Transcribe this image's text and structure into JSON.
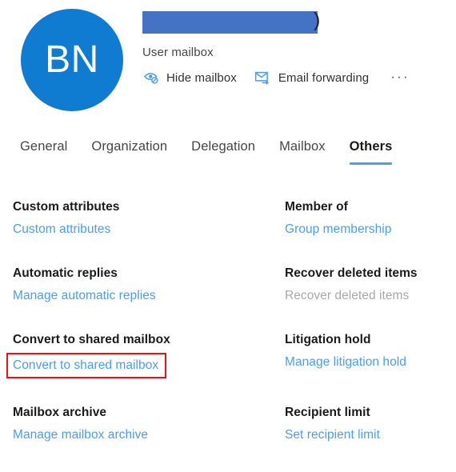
{
  "header": {
    "avatar_initials": "BN",
    "avatar_color": "#0f7bd1",
    "display_name_redacted": "",
    "display_name_visible_tail": ")",
    "redaction_color": "#4472c4",
    "mailbox_type": "User mailbox"
  },
  "command_bar": {
    "items": [
      {
        "label": "Hide mailbox",
        "icon": "hide-mailbox-eye-icon"
      },
      {
        "label": "Email forwarding",
        "icon": "email-forwarding-envelope-icon"
      }
    ],
    "overflow_label": "···"
  },
  "tabs": {
    "active_index": 4,
    "items": [
      {
        "label": "General"
      },
      {
        "label": "Organization"
      },
      {
        "label": "Delegation"
      },
      {
        "label": "Mailbox"
      },
      {
        "label": "Others"
      }
    ],
    "active_underline_color": "#4a9ef0"
  },
  "sections": [
    {
      "title": "Custom attributes",
      "link": "Custom attributes",
      "state": "enabled",
      "column": "left"
    },
    {
      "title": "Member of",
      "link": "Group membership",
      "state": "enabled",
      "column": "right"
    },
    {
      "title": "Automatic replies",
      "link": "Manage automatic replies",
      "state": "enabled",
      "column": "left"
    },
    {
      "title": "Recover deleted items",
      "link": "Recover deleted items",
      "state": "disabled",
      "column": "right"
    },
    {
      "title": "Convert to shared mailbox",
      "link": "Convert to shared mailbox",
      "state": "highlighted",
      "column": "left"
    },
    {
      "title": "Litigation hold",
      "link": "Manage litigation hold",
      "state": "enabled",
      "column": "right"
    },
    {
      "title": "Mailbox archive",
      "link": "Manage mailbox archive",
      "state": "enabled",
      "column": "left"
    },
    {
      "title": "Recipient limit",
      "link": "Set recipient limit",
      "state": "enabled",
      "column": "right"
    }
  ],
  "colors": {
    "link": "#4a9ef0",
    "link_disabled": "#a9a8a6",
    "highlight_box": "#ee1111",
    "heading": "#1b1a19"
  }
}
